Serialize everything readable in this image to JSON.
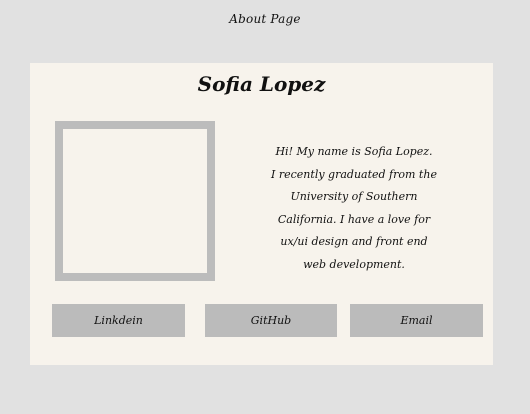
{
  "header": {
    "title": "About Page"
  },
  "profile": {
    "name": "Sofia Lopez",
    "bio_lines": [
      "Hi! My name is Sofia Lopez.",
      "I recently graduated from the",
      "University of Southern",
      "California. I have a love for",
      "ux/ui design and front end",
      "web development."
    ]
  },
  "buttons": {
    "linkedin": "Linkdein",
    "github": "GitHub",
    "email": "Email"
  },
  "colors": {
    "page_background": "#e1e1e1",
    "card_background": "#f7f3ec",
    "button_background": "#bbbbbb",
    "photo_frame": "#bcbcbc"
  }
}
